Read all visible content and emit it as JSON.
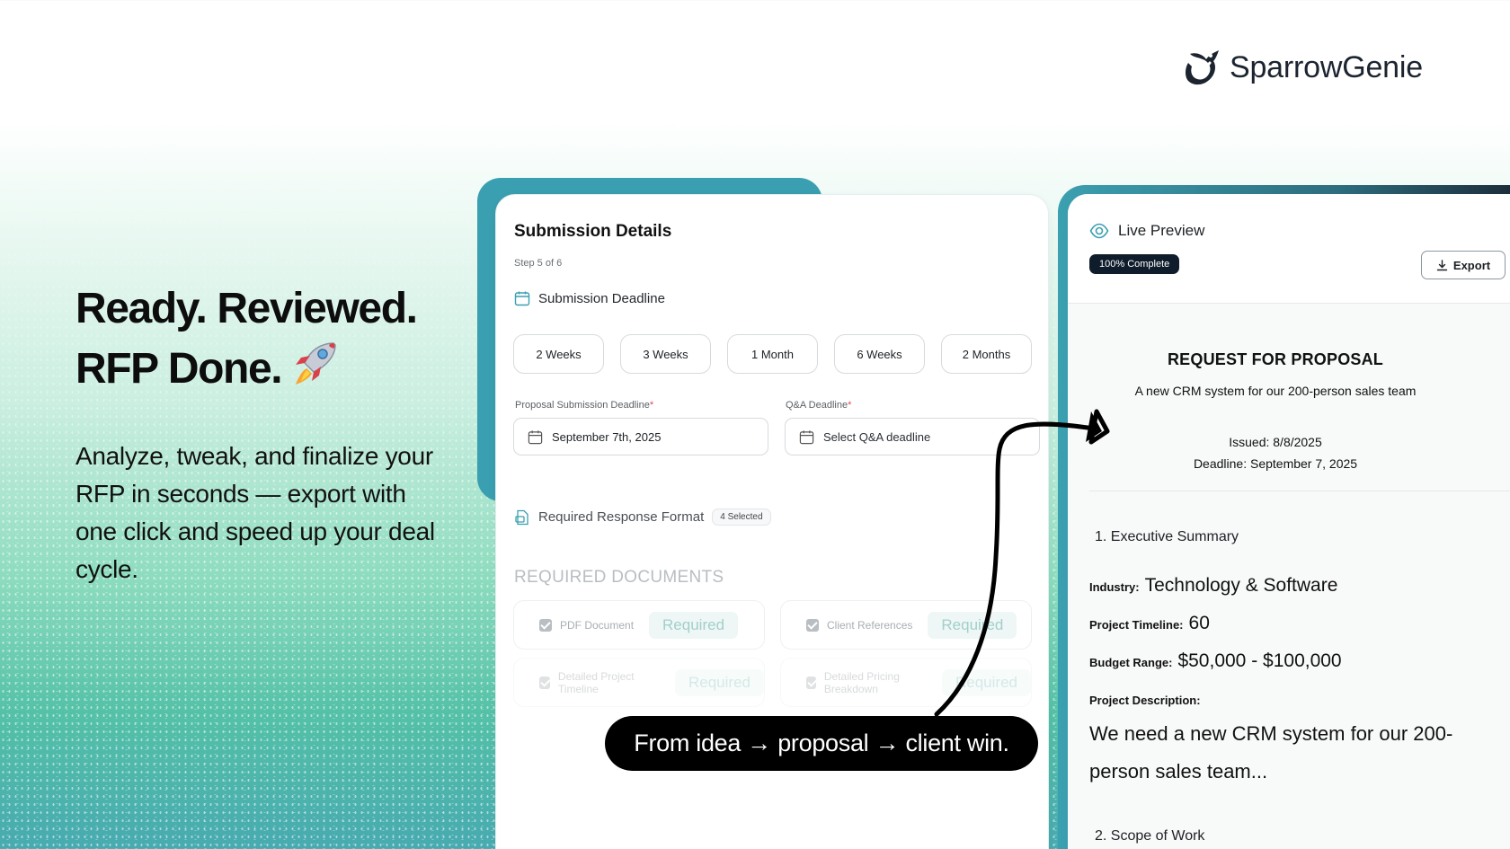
{
  "brand": {
    "name": "SparrowGenie",
    "logo_icon": "sparrow-logo-icon"
  },
  "hero": {
    "title_line1": "Ready. Reviewed.",
    "title_line2": "RFP Done.",
    "title_emoji_icon": "rocket-icon",
    "subtitle": "Analyze, tweak, and finalize your RFP in seconds — export with one click and speed up your deal cycle."
  },
  "submission": {
    "title": "Submission Details",
    "step": "Step 5 of 6",
    "deadline_section": "Submission Deadline",
    "deadline_options": [
      "2 Weeks",
      "3 Weeks",
      "1 Month",
      "6 Weeks",
      "2 Months"
    ],
    "proposal_label": "Proposal Submission Deadline",
    "proposal_value": "September 7th, 2025",
    "qa_label": "Q&A Deadline",
    "qa_placeholder": "Select Q&A deadline",
    "required_mark": "*",
    "format_section": "Required Response Format",
    "format_badge": "4 Selected",
    "required_docs_title": "REQUIRED DOCUMENTS",
    "documents": [
      {
        "name": "PDF Document",
        "tag": "Required"
      },
      {
        "name": "Client References",
        "tag": "Required"
      },
      {
        "name": "Detailed Project Timeline",
        "tag": "Required"
      },
      {
        "name": "Detailed Pricing Breakdown",
        "tag": "Required"
      }
    ]
  },
  "preview": {
    "title": "Live Preview",
    "status": "100% Complete",
    "export_label": "Export",
    "doc_title": "REQUEST FOR PROPOSAL",
    "doc_subtitle": "A new CRM system for our 200-person sales team",
    "issued": "Issued: 8/8/2025",
    "deadline": "Deadline: September 7, 2025",
    "section1": "1.  Executive Summary",
    "industry_label": "Industry:",
    "industry_value": "Technology & Software",
    "timeline_label": "Project Timeline:",
    "timeline_value": "60",
    "budget_label": "Budget Range:",
    "budget_value": "$50,000 - $100,000",
    "description_label": "Project Description:",
    "description_value": "We need a new CRM system for our 200-person sales team...",
    "section2": "2.  Scope of Work"
  },
  "tagline": "From idea → proposal → client win.",
  "colors": {
    "teal": "#3a9fb0",
    "navy": "#0f1c2b",
    "brand_text": "#1c2430"
  }
}
